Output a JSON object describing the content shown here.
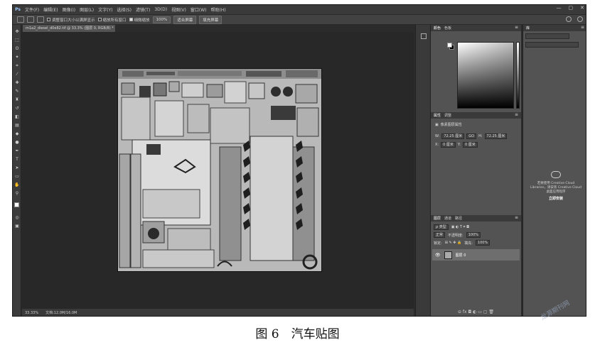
{
  "menubar": {
    "logo": "Ps",
    "items": [
      "文件(F)",
      "编辑(E)",
      "图像(I)",
      "图层(L)",
      "文字(Y)",
      "选择(S)",
      "滤镜(T)",
      "3D(D)",
      "视图(V)",
      "窗口(W)",
      "帮助(H)"
    ],
    "window_controls": [
      "—",
      "▢",
      "✕"
    ]
  },
  "options_bar": {
    "check1": "调整窗口大小以满屏显示",
    "check2": "缩放所有窗口",
    "check3": "细微缩放",
    "zoom_value": "100%",
    "fit_screen": "适合屏幕",
    "fill_screen": "填充屏幕"
  },
  "document": {
    "tab_title": "m1a2_diesel_d0e82.tif @ 33.3% (图层 0, RGB/8) *",
    "zoom": "33.33%",
    "doc_info": "文档:12.0M/16.0M"
  },
  "color_panel": {
    "tab_active": "颜色",
    "tab_other": "色板"
  },
  "properties_panel": {
    "tab_active": "属性",
    "tab_other": "调整",
    "title": "像素图层属性",
    "w_label": "W:",
    "w_value": "72.25 厘米",
    "go": "GO",
    "h_label": "H:",
    "h_value": "72.25 厘米",
    "x_label": "X:",
    "x_value": "0 厘米",
    "y_label": "Y:",
    "y_value": "0 厘米"
  },
  "layers_panel": {
    "tab_active": "图层",
    "tab_channels": "通道",
    "tab_paths": "路径",
    "kind": "ρ 类型",
    "blend": "正常",
    "opacity_label": "不透明度:",
    "opacity_value": "100%",
    "lock_label": "锁定:",
    "fill_label": "填充:",
    "fill_value": "100%",
    "layer_name": "图层 0",
    "footer_icons": "⊖ fx ◘ ◐ ▭ ▢ 🗑"
  },
  "libraries_panel": {
    "tab": "库",
    "message": "若要使用 Creative Cloud Libraries，请安装 Creative Cloud 桌面应用程序",
    "button": "立即安装"
  },
  "caption": "图 6　汽车贴图",
  "watermark": "龙源期刊网"
}
